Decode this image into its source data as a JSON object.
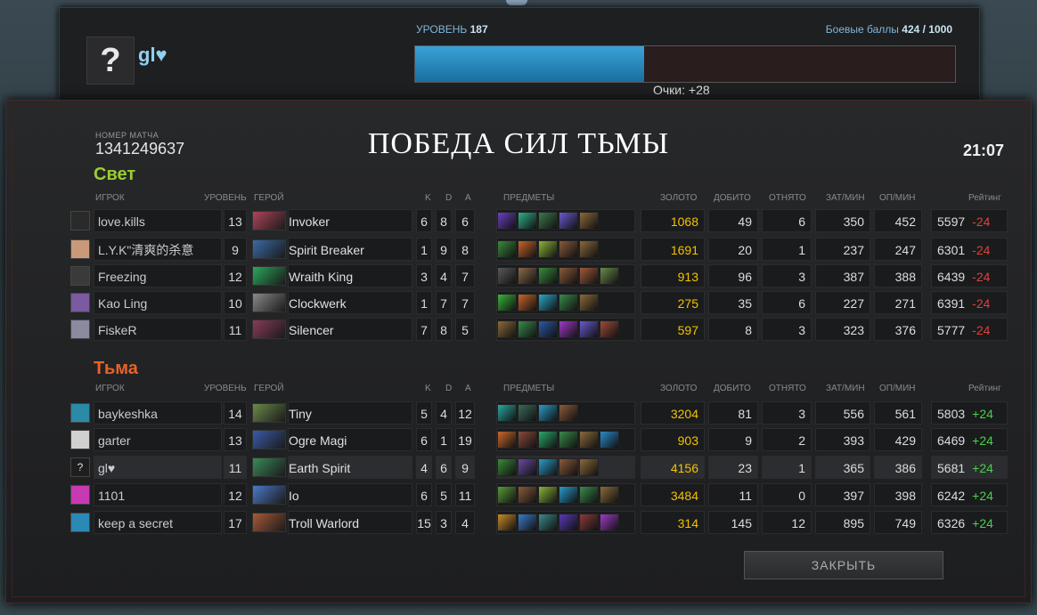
{
  "profile": {
    "avatar_glyph": "?",
    "name": "gl♥",
    "level_label": "УРОВЕНЬ",
    "level": "187",
    "bp_label": "Боевые баллы",
    "bp_value": "424 / 1000",
    "bp_fraction": 0.424,
    "points": "Очки: +28"
  },
  "match": {
    "id_label": "НОМЕР МАТЧА",
    "id": "1341249637",
    "result": "ПОБЕДА СИЛ ТЬМЫ",
    "duration": "21:07"
  },
  "columns": {
    "player": "ИГРОК",
    "level": "УРОВЕНЬ",
    "hero": "ГЕРОЙ",
    "k": "K",
    "d": "D",
    "a": "A",
    "items": "ПРЕДМЕТЫ",
    "gold": "ЗОЛОТО",
    "lh": "ДОБИТО",
    "dn": "ОТНЯТО",
    "gpm": "ЗАТ/МИН",
    "xpm": "ОП/МИН",
    "rating": "Рейтинг"
  },
  "radiant": {
    "name": "Свет",
    "color": "#9acd32",
    "players": [
      {
        "name": "love.kills",
        "level": "13",
        "hero": "Invoker",
        "k": "6",
        "d": "8",
        "a": "6",
        "gold": "1068",
        "lh": "49",
        "dn": "6",
        "gpm": "350",
        "xpm": "452",
        "rating": "5597",
        "change": "-24",
        "av": "#2a2a2a",
        "hc": "#b0445a",
        "items": [
          "#6a3fc0",
          "#2fb08a",
          "#3b7a4a",
          "#6a5acd",
          "#8a6a3a"
        ]
      },
      {
        "name": "L.Y.K\"清爽的杀意",
        "level": "9",
        "hero": "Spirit Breaker",
        "k": "1",
        "d": "9",
        "a": "8",
        "gold": "1691",
        "lh": "20",
        "dn": "1",
        "gpm": "237",
        "xpm": "247",
        "rating": "6301",
        "change": "-24",
        "av": "#c89a7a",
        "hc": "#3a6aa8",
        "items": [
          "#3a8a3a",
          "#c8642a",
          "#8ab43a",
          "#8a5a3a",
          "#8a6a3a"
        ]
      },
      {
        "name": "Freezing",
        "level": "12",
        "hero": "Wraith King",
        "k": "3",
        "d": "4",
        "a": "7",
        "gold": "913",
        "lh": "96",
        "dn": "3",
        "gpm": "387",
        "xpm": "388",
        "rating": "6439",
        "change": "-24",
        "av": "#3a3a3a",
        "hc": "#2aa85a",
        "items": [
          "#5a5a5a",
          "#8a6a4a",
          "#3a8a3a",
          "#8a5a3a",
          "#a05a3a",
          "#6a8a4a"
        ]
      },
      {
        "name": "Kao Ling",
        "level": "10",
        "hero": "Clockwerk",
        "k": "1",
        "d": "7",
        "a": "7",
        "gold": "275",
        "lh": "35",
        "dn": "6",
        "gpm": "227",
        "xpm": "271",
        "rating": "6391",
        "change": "-24",
        "av": "#7a5aa0",
        "hc": "#8a8a8a",
        "items": [
          "#3ab43a",
          "#c8642a",
          "#2aa8c8",
          "#3a8a4a",
          "#8a6a3a"
        ]
      },
      {
        "name": "FiskeR",
        "level": "11",
        "hero": "Silencer",
        "k": "7",
        "d": "8",
        "a": "5",
        "gold": "597",
        "lh": "8",
        "dn": "3",
        "gpm": "323",
        "xpm": "376",
        "rating": "5777",
        "change": "-24",
        "av": "#8a8aa0",
        "hc": "#8a3a5a",
        "items": [
          "#8a6a3a",
          "#3a8a4a",
          "#2a5aa8",
          "#a03ac8",
          "#6a5acd",
          "#a04a3a"
        ]
      }
    ]
  },
  "dire": {
    "name": "Тьма",
    "color": "#e8622a",
    "players": [
      {
        "name": "baykeshka",
        "level": "14",
        "hero": "Tiny",
        "k": "5",
        "d": "4",
        "a": "12",
        "gold": "3204",
        "lh": "81",
        "dn": "3",
        "gpm": "556",
        "xpm": "561",
        "rating": "5803",
        "change": "+24",
        "av": "#2a8aa8",
        "hc": "#6a8a4a",
        "items": [
          "#2aa8a0",
          "#3a6a5a",
          "#2a9ac8",
          "#8a5a3a"
        ]
      },
      {
        "name": "garter",
        "level": "13",
        "hero": "Ogre Magi",
        "k": "6",
        "d": "1",
        "a": "19",
        "gold": "903",
        "lh": "9",
        "dn": "2",
        "gpm": "393",
        "xpm": "429",
        "rating": "6469",
        "change": "+24",
        "av": "#d0d0d0",
        "hc": "#3a5aa8",
        "items": [
          "#c86a2a",
          "#8a4a3a",
          "#2aa86a",
          "#3a8a4a",
          "#8a6a3a",
          "#2a8ac8"
        ]
      },
      {
        "name": "gl♥",
        "level": "11",
        "hero": "Earth Spirit",
        "k": "4",
        "d": "6",
        "a": "9",
        "gold": "4156",
        "lh": "23",
        "dn": "1",
        "gpm": "365",
        "xpm": "386",
        "rating": "5681",
        "change": "+24",
        "av": "#1e1e1e",
        "hc": "#3a8a5a",
        "items": [
          "#3a8a3a",
          "#6a4aa0",
          "#2a9ac8",
          "#8a5a3a",
          "#8a6a3a"
        ]
      },
      {
        "name": "1101",
        "level": "12",
        "hero": "Io",
        "k": "6",
        "d": "5",
        "a": "11",
        "gold": "3484",
        "lh": "11",
        "dn": "0",
        "gpm": "397",
        "xpm": "398",
        "rating": "6242",
        "change": "+24",
        "av": "#c83ab4",
        "hc": "#4a7ac8",
        "items": [
          "#5a9a3a",
          "#8a5a3a",
          "#8ab43a",
          "#2a9ac8",
          "#3a8a4a",
          "#8a6a3a"
        ]
      },
      {
        "name": "keep a secret",
        "level": "17",
        "hero": "Troll Warlord",
        "k": "15",
        "d": "3",
        "a": "4",
        "gold": "314",
        "lh": "145",
        "dn": "12",
        "gpm": "895",
        "xpm": "749",
        "rating": "6326",
        "change": "+24",
        "av": "#2a8ab4",
        "hc": "#a85a3a",
        "items": [
          "#c88a2a",
          "#3a7ac8",
          "#3a8a8a",
          "#5a3ab4",
          "#8a3a3a",
          "#a03ac8"
        ]
      }
    ]
  },
  "close_label": "ЗАКРЫТЬ"
}
